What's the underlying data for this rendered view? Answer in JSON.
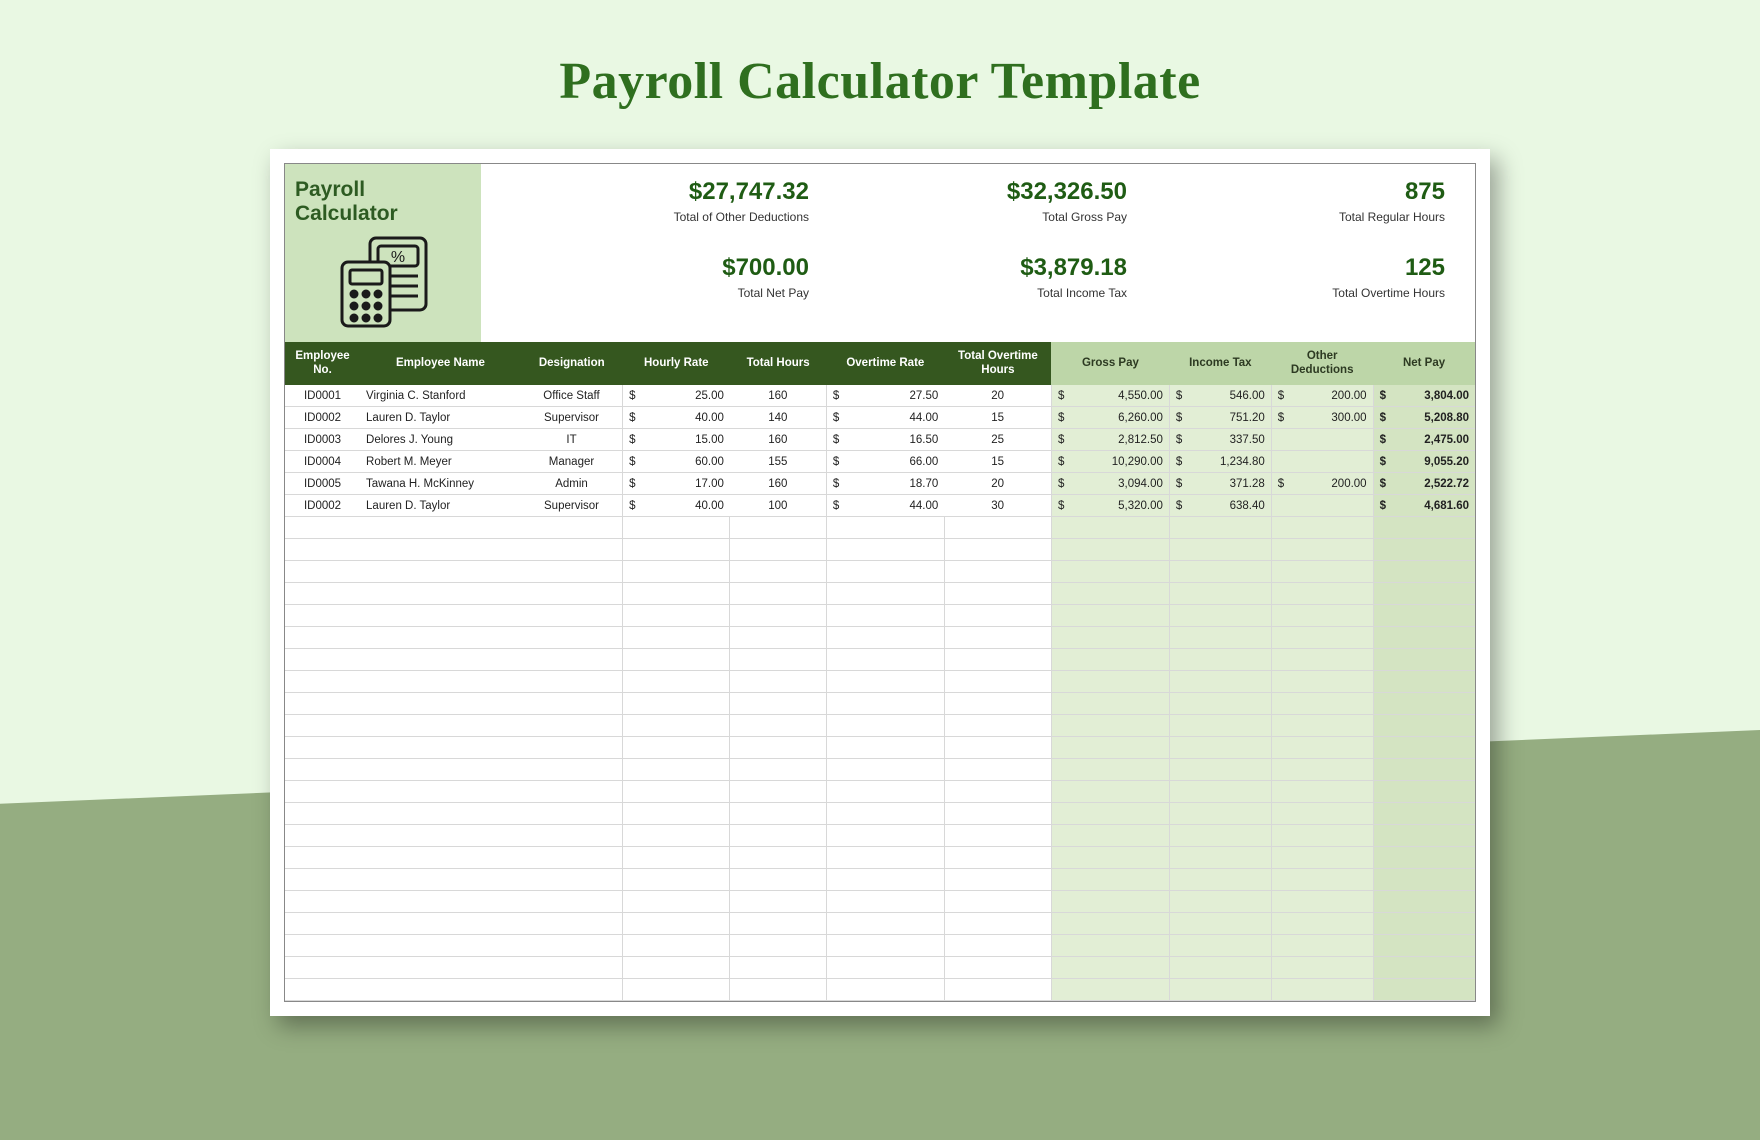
{
  "page": {
    "title": "Payroll Calculator Template"
  },
  "brand": {
    "title": "Payroll Calculator"
  },
  "stats": {
    "row1": [
      {
        "value": "$27,747.32",
        "label": "Total of Other Deductions"
      },
      {
        "value": "$32,326.50",
        "label": "Total Gross Pay"
      },
      {
        "value": "875",
        "label": "Total Regular Hours"
      }
    ],
    "row2": [
      {
        "value": "$700.00",
        "label": "Total Net Pay"
      },
      {
        "value": "$3,879.18",
        "label": "Total Income Tax"
      },
      {
        "value": "125",
        "label": "Total Overtime Hours"
      }
    ]
  },
  "table": {
    "headers": {
      "emp_no": "Employee No.",
      "name": "Employee Name",
      "desig": "Designation",
      "rate": "Hourly Rate",
      "hours": "Total Hours",
      "ot_rate": "Overtime Rate",
      "ot_hours": "Total Overtime Hours",
      "gross": "Gross Pay",
      "tax": "Income Tax",
      "other": "Other Deductions",
      "net": "Net Pay"
    },
    "rows": [
      {
        "emp_no": "ID0001",
        "name": "Virginia C. Stanford",
        "desig": "Office Staff",
        "rate": "25.00",
        "hours": "160",
        "ot_rate": "27.50",
        "ot_hours": "20",
        "gross": "4,550.00",
        "tax": "546.00",
        "other": "200.00",
        "net": "3,804.00"
      },
      {
        "emp_no": "ID0002",
        "name": "Lauren D. Taylor",
        "desig": "Supervisor",
        "rate": "40.00",
        "hours": "140",
        "ot_rate": "44.00",
        "ot_hours": "15",
        "gross": "6,260.00",
        "tax": "751.20",
        "other": "300.00",
        "net": "5,208.80"
      },
      {
        "emp_no": "ID0003",
        "name": "Delores J. Young",
        "desig": "IT",
        "rate": "15.00",
        "hours": "160",
        "ot_rate": "16.50",
        "ot_hours": "25",
        "gross": "2,812.50",
        "tax": "337.50",
        "other": "",
        "net": "2,475.00"
      },
      {
        "emp_no": "ID0004",
        "name": "Robert M. Meyer",
        "desig": "Manager",
        "rate": "60.00",
        "hours": "155",
        "ot_rate": "66.00",
        "ot_hours": "15",
        "gross": "10,290.00",
        "tax": "1,234.80",
        "other": "",
        "net": "9,055.20"
      },
      {
        "emp_no": "ID0005",
        "name": "Tawana H. McKinney",
        "desig": "Admin",
        "rate": "17.00",
        "hours": "160",
        "ot_rate": "18.70",
        "ot_hours": "20",
        "gross": "3,094.00",
        "tax": "371.28",
        "other": "200.00",
        "net": "2,522.72"
      },
      {
        "emp_no": "ID0002",
        "name": "Lauren D. Taylor",
        "desig": "Supervisor",
        "rate": "40.00",
        "hours": "100",
        "ot_rate": "44.00",
        "ot_hours": "30",
        "gross": "5,320.00",
        "tax": "638.40",
        "other": "",
        "net": "4,681.60"
      }
    ],
    "empty_rows": 22,
    "currency": "$"
  },
  "colors": {
    "dark_green": "#35571f",
    "light_green": "#bdd6a8",
    "brand_bg": "#cde3bd"
  }
}
